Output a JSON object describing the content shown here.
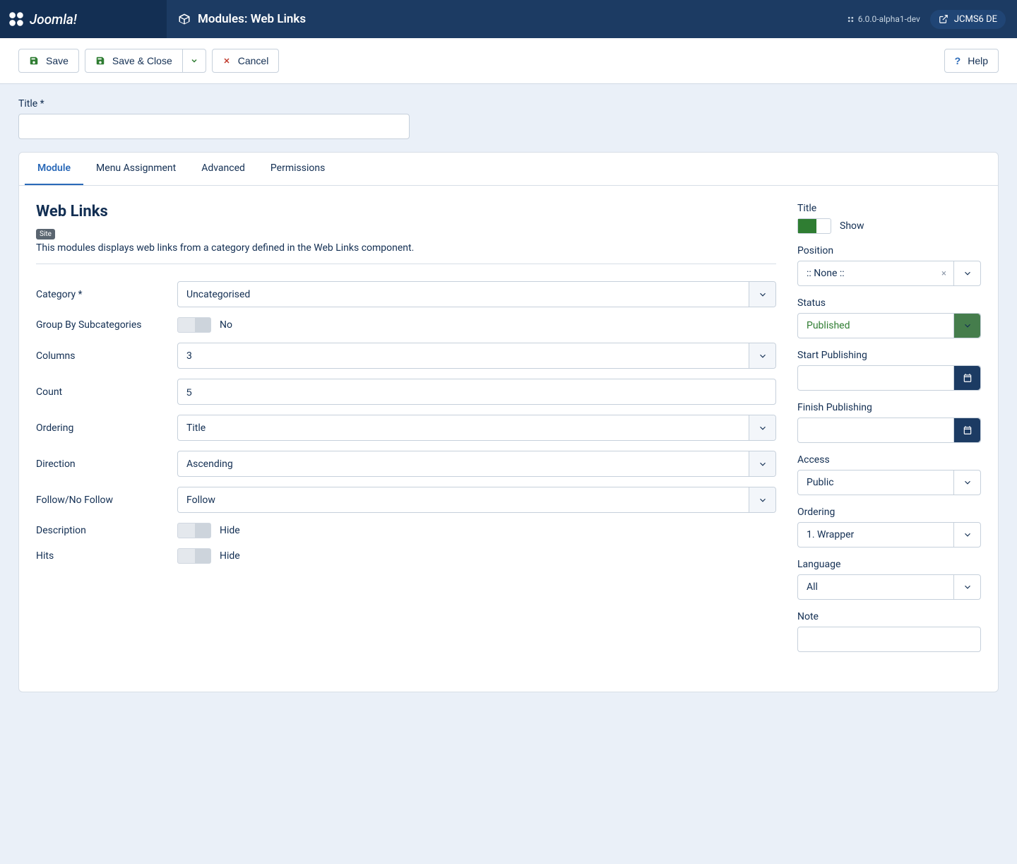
{
  "header": {
    "logo_text": "Joomla!",
    "page_title": "Modules: Web Links",
    "version": "6.0.0-alpha1-dev",
    "user": "JCMS6 DE"
  },
  "toolbar": {
    "save": "Save",
    "save_close": "Save & Close",
    "cancel": "Cancel",
    "help": "Help"
  },
  "title_field": {
    "label": "Title *",
    "value": ""
  },
  "tabs": [
    "Module",
    "Menu Assignment",
    "Advanced",
    "Permissions"
  ],
  "module": {
    "heading": "Web Links",
    "badge": "Site",
    "description": "This modules displays web links from a category defined in the Web Links component.",
    "fields": {
      "category": {
        "label": "Category *",
        "value": "Uncategorised"
      },
      "group_by": {
        "label": "Group By Subcategories",
        "value": "No"
      },
      "columns": {
        "label": "Columns",
        "value": "3"
      },
      "count": {
        "label": "Count",
        "value": "5"
      },
      "ordering": {
        "label": "Ordering",
        "value": "Title"
      },
      "direction": {
        "label": "Direction",
        "value": "Ascending"
      },
      "follow": {
        "label": "Follow/No Follow",
        "value": "Follow"
      },
      "desc": {
        "label": "Description",
        "value": "Hide"
      },
      "hits": {
        "label": "Hits",
        "value": "Hide"
      }
    }
  },
  "sidebar": {
    "title": {
      "label": "Title",
      "value": "Show"
    },
    "position": {
      "label": "Position",
      "value": ":: None ::"
    },
    "status": {
      "label": "Status",
      "value": "Published"
    },
    "start_pub": {
      "label": "Start Publishing",
      "value": ""
    },
    "finish_pub": {
      "label": "Finish Publishing",
      "value": ""
    },
    "access": {
      "label": "Access",
      "value": "Public"
    },
    "ordering": {
      "label": "Ordering",
      "value": "1. Wrapper"
    },
    "language": {
      "label": "Language",
      "value": "All"
    },
    "note": {
      "label": "Note",
      "value": ""
    }
  }
}
